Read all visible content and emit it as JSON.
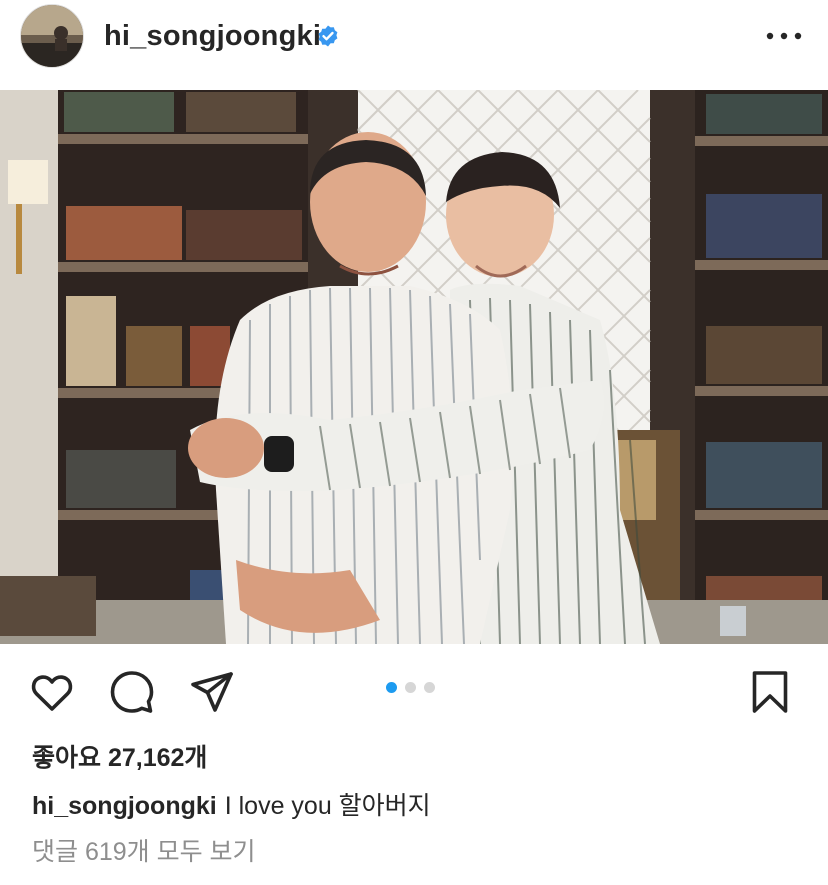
{
  "header": {
    "username": "hi_songjoongki",
    "verified": true,
    "more_icon": "more-horizontal-icon"
  },
  "post": {
    "image_description_icon": "post-photo",
    "carousel": {
      "total": 3,
      "active_index": 0
    }
  },
  "actions": {
    "icons": [
      "heart-icon",
      "comment-icon",
      "share-icon",
      "bookmark-icon"
    ]
  },
  "likes": {
    "text": "좋아요 27,162개"
  },
  "caption": {
    "username": "hi_songjoongki",
    "text": "I love you 할아버지"
  },
  "comments": {
    "text": "댓글 619개 모두 보기"
  },
  "colors": {
    "accent_dot": "#1d9bf0",
    "inactive_dot": "#d6d6d6",
    "verified_blue": "#3897f0",
    "secondary_text": "#8e8e8e"
  }
}
